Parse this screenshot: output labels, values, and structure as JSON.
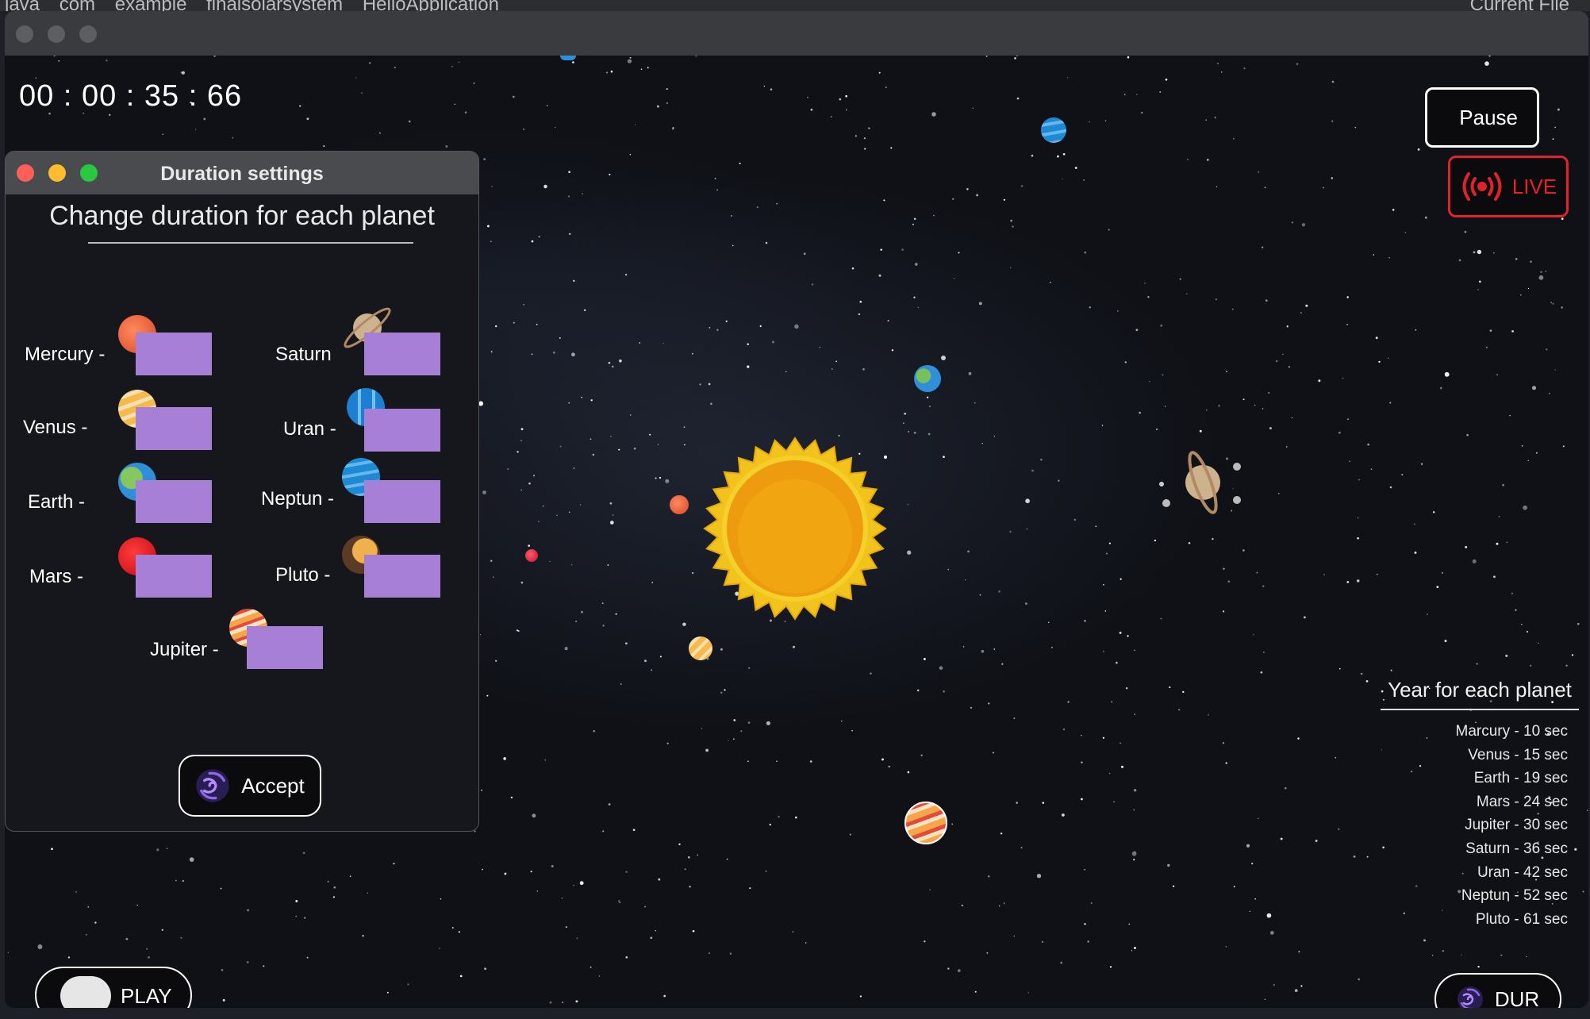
{
  "ide": {
    "breadcrumbs": [
      "java",
      "com",
      "example",
      "finalsolarsystem",
      "HelloApplication"
    ],
    "current_file": "Current File"
  },
  "timer": "00 : 00 : 35 : 66",
  "controls": {
    "pause_label": "Pause",
    "live_label": "LIVE",
    "dur_label": "DUR",
    "play_label": "PLAY"
  },
  "years_panel": {
    "title": "Year for each planet",
    "items": [
      "Marcury - 10 sec",
      "Venus - 15 sec",
      "Earth - 19 sec",
      "Mars - 24 sec",
      "Jupiter - 30 sec",
      "Saturn - 36 sec",
      "Uran - 42 sec",
      "Neptun - 52 sec",
      "Pluto - 61 sec"
    ]
  },
  "dialog": {
    "title": "Duration settings",
    "heading": "Change duration for each planet",
    "planets": {
      "mercury": "Mercury -",
      "venus": "Venus -",
      "earth": "Earth -",
      "mars": "Mars -",
      "saturn": "Saturn",
      "uran": "Uran -",
      "neptun": "Neptun -",
      "pluto": "Pluto -",
      "jupiter": "Jupiter -"
    },
    "accept_label": "Accept"
  },
  "colors": {
    "accent_purple": "#a77fd6",
    "live_red": "#e3212a",
    "sun": "#f2a20e"
  }
}
